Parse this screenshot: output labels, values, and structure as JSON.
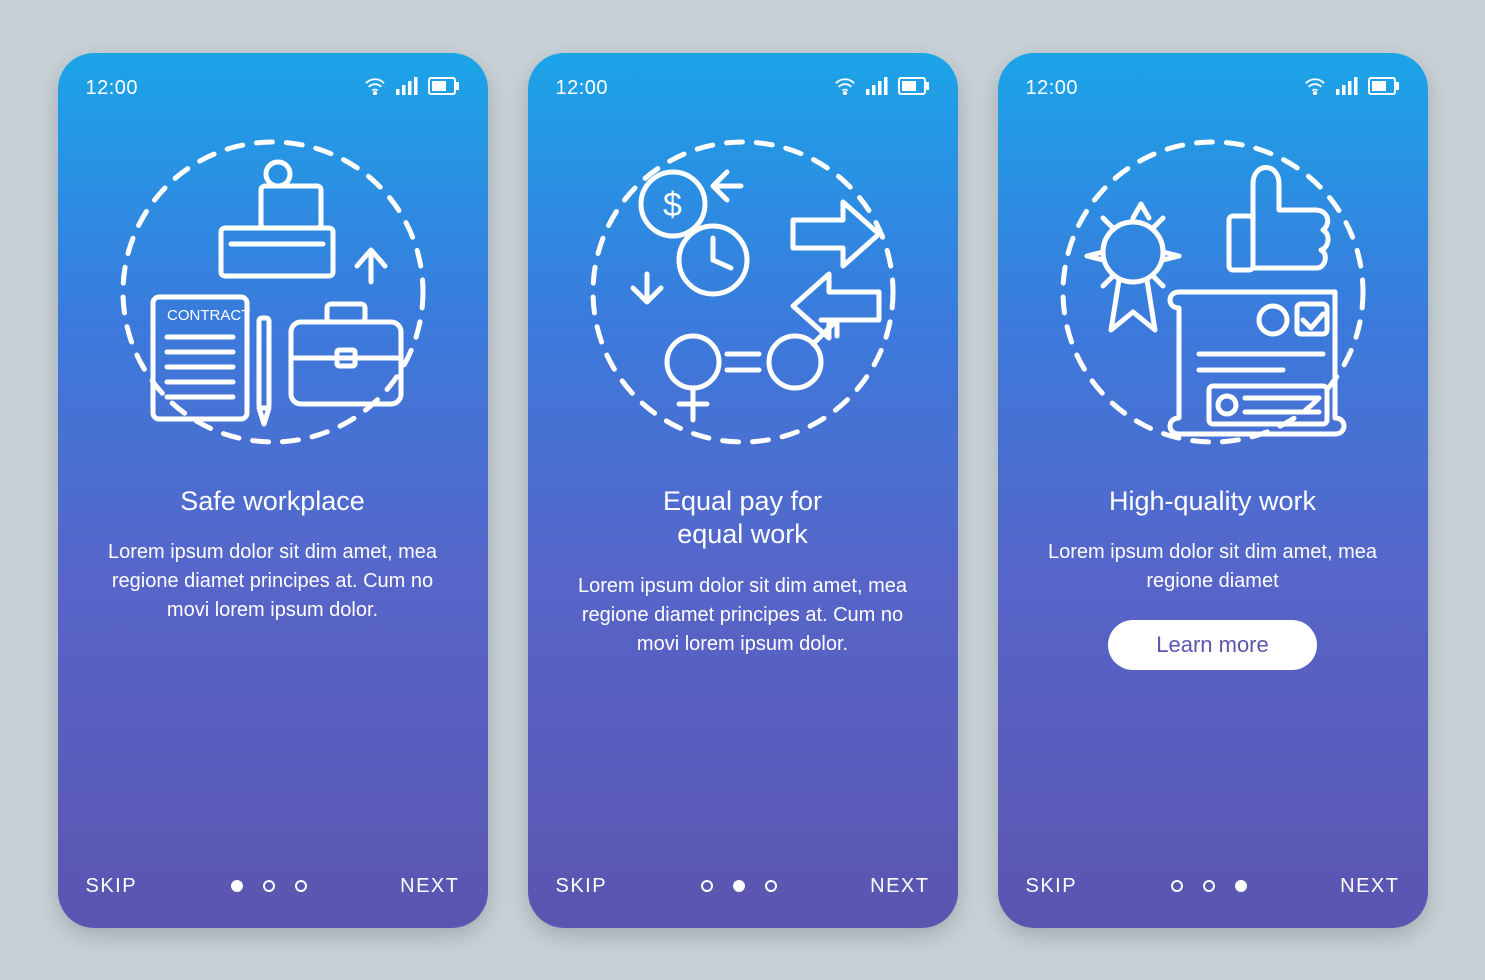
{
  "status": {
    "time": "12:00"
  },
  "screens": [
    {
      "title": "Safe workplace",
      "body": "Lorem ipsum dolor sit dim amet, mea regione diamet principes at. Cum no movi lorem ipsum dolor.",
      "contract_label": "CONTRACT",
      "skip": "SKIP",
      "next": "NEXT",
      "active_dot": 0,
      "has_learn": false
    },
    {
      "title": "Equal pay for\nequal work",
      "body": "Lorem ipsum dolor sit dim amet, mea regione diamet principes at. Cum no movi lorem ipsum dolor.",
      "skip": "SKIP",
      "next": "NEXT",
      "active_dot": 1,
      "has_learn": false
    },
    {
      "title": "High-quality work",
      "body": "Lorem ipsum dolor sit dim amet, mea regione diamet",
      "skip": "SKIP",
      "next": "NEXT",
      "active_dot": 2,
      "has_learn": true,
      "learn_label": "Learn more"
    }
  ]
}
